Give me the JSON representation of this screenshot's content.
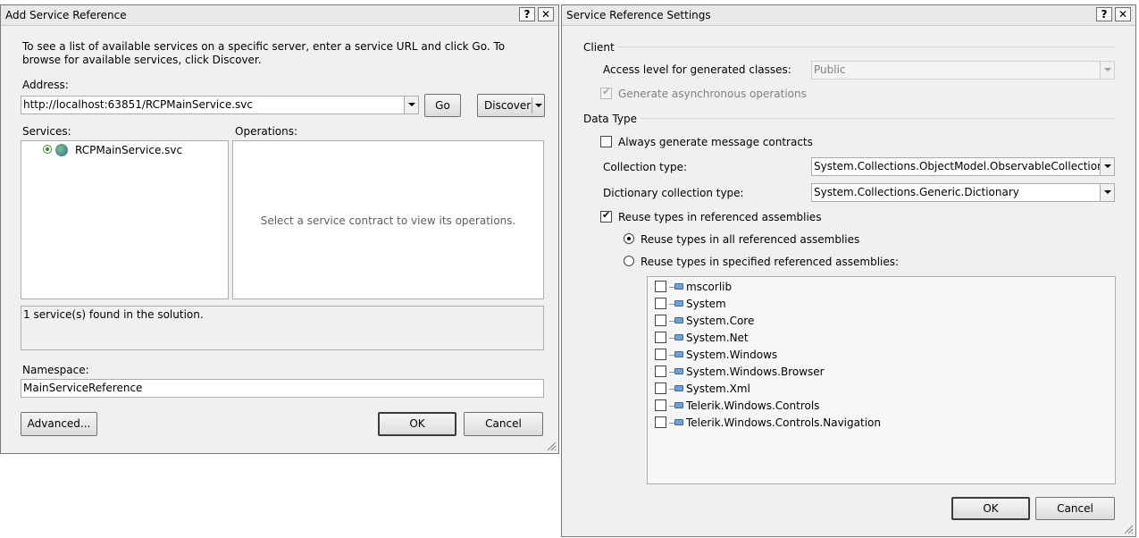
{
  "left_dialog": {
    "title": "Add Service Reference",
    "help": "?",
    "close": "✕",
    "instructions": "To see a list of available services on a specific server, enter a service URL and click Go. To browse for available services, click Discover.",
    "address_label": "Address:",
    "address_value": "http://localhost:63851/RCPMainService.svc",
    "go_label": "Go",
    "discover_label": "Discover",
    "services_label": "Services:",
    "operations_label": "Operations:",
    "service_item": "RCPMainService.svc",
    "operations_placeholder": "Select a service contract to view its operations.",
    "status_text": "1 service(s) found in the solution.",
    "namespace_label": "Namespace:",
    "namespace_value": "MainServiceReference",
    "advanced_label": "Advanced...",
    "ok_label": "OK",
    "cancel_label": "Cancel"
  },
  "right_dialog": {
    "title": "Service Reference Settings",
    "help": "?",
    "close": "✕",
    "client_group": "Client",
    "access_level_label": "Access level for generated classes:",
    "access_level_value": "Public",
    "async_label": "Generate asynchronous operations",
    "data_type_group": "Data Type",
    "always_message_contracts_label": "Always generate message contracts",
    "collection_type_label": "Collection type:",
    "collection_type_value": "System.Collections.ObjectModel.ObservableCollection",
    "dictionary_type_label": "Dictionary collection type:",
    "dictionary_type_value": "System.Collections.Generic.Dictionary",
    "reuse_types_label": "Reuse types in referenced assemblies",
    "reuse_all_label": "Reuse types in all referenced assemblies",
    "reuse_specified_label": "Reuse types in specified referenced assemblies:",
    "assemblies": [
      "mscorlib",
      "System",
      "System.Core",
      "System.Net",
      "System.Windows",
      "System.Windows.Browser",
      "System.Xml",
      "Telerik.Windows.Controls",
      "Telerik.Windows.Controls.Navigation"
    ],
    "ok_label": "OK",
    "cancel_label": "Cancel"
  },
  "colors": {
    "dialog_bg": "#f0f0f0",
    "border": "#7a7a7a",
    "icon_blue": "#6fa0d8"
  }
}
